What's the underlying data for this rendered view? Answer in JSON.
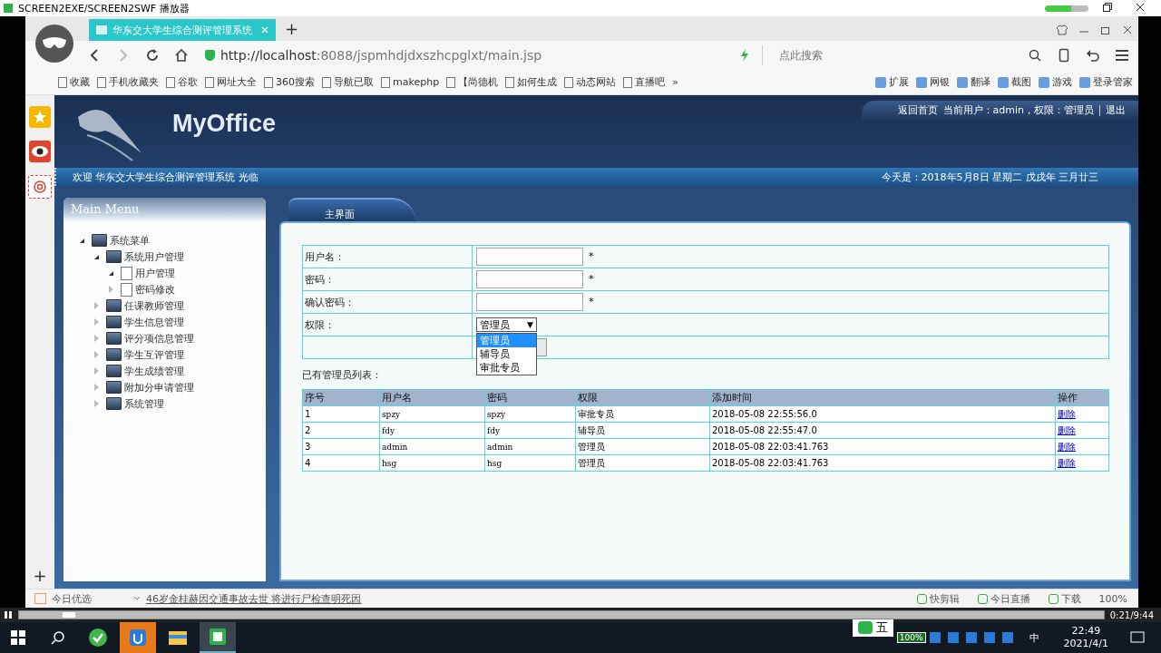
{
  "player": {
    "title": "SCREEN2EXE/SCREEN2SWF 播放器",
    "time": "0:21/9:44",
    "level": 0.04
  },
  "browser": {
    "tabs": [
      {
        "label": "华东交大学生综合测评管理系统",
        "selected": true
      }
    ],
    "new_tab": "+",
    "url_host": "http://localhost",
    "url_rest": ":8088/jspmhdjdxszhcpglxt/main.jsp",
    "search": {
      "placeholder": "点此搜索"
    },
    "bookmarks": [
      {
        "label": "收藏"
      },
      {
        "label": "手机收藏夹"
      },
      {
        "label": "谷歌"
      },
      {
        "label": "网址大全"
      },
      {
        "label": "360搜索"
      },
      {
        "label": "导航已取"
      },
      {
        "label": "makephp"
      },
      {
        "label": "【尚德机"
      },
      {
        "label": "如何生成"
      },
      {
        "label": "动态网站"
      },
      {
        "label": "直播吧"
      }
    ],
    "more": "»",
    "tools": [
      {
        "label": "扩展"
      },
      {
        "label": "网银"
      },
      {
        "label": "翻译"
      },
      {
        "label": "截图"
      },
      {
        "label": "游戏"
      },
      {
        "label": "登录管家"
      }
    ],
    "status": {
      "left": "今日优选",
      "news": "46岁金桂赫因交通事故去世 将进行尸检查明死因",
      "items": [
        {
          "label": "快剪辑"
        },
        {
          "label": "今日直播"
        },
        {
          "label": "下载"
        }
      ],
      "zoom": "100%"
    },
    "sidebar_add": "+"
  },
  "page": {
    "logo": "MyOffice",
    "top_links": [
      {
        "label": "返回首页"
      },
      {
        "label": "当前用户：admin，权限：管理员"
      },
      {
        "label": "退出"
      }
    ],
    "welcome": "欢迎 华东交大学生综合测评管理系统 光临",
    "today": "今天是：2018年5月8日 星期二 戊戌年 三月廿三",
    "menu_title": "Main Menu",
    "tree": [
      {
        "label": "系统菜单",
        "kind": "folder",
        "expanded": true,
        "children": [
          {
            "label": "系统用户管理",
            "kind": "folder",
            "expanded": true,
            "children": [
              {
                "label": "用户管理",
                "kind": "file",
                "expanded": true
              },
              {
                "label": "密码修改",
                "kind": "file",
                "expanded": false
              }
            ]
          },
          {
            "label": "任课教师管理",
            "kind": "folder",
            "expanded": false
          },
          {
            "label": "学生信息管理",
            "kind": "folder",
            "expanded": false
          },
          {
            "label": "评分项信息管理",
            "kind": "folder",
            "expanded": false
          },
          {
            "label": "学生互评管理",
            "kind": "folder",
            "expanded": false
          },
          {
            "label": "学生成绩管理",
            "kind": "folder",
            "expanded": false
          },
          {
            "label": "附加分申请管理",
            "kind": "folder",
            "expanded": false
          },
          {
            "label": "系统管理",
            "kind": "folder",
            "expanded": false
          }
        ]
      }
    ],
    "main_tab": {
      "label": "主界面",
      "selected": true
    },
    "form": [
      {
        "label": "用户名：",
        "kind": "text",
        "required": "*"
      },
      {
        "label": "密码：",
        "kind": "text",
        "required": "*"
      },
      {
        "label": "确认密码：",
        "kind": "text",
        "required": "*"
      },
      {
        "label": "权限：",
        "kind": "select",
        "value": "管理员",
        "arrow": "▼",
        "options": [
          {
            "label": "管理员",
            "selected": true
          },
          {
            "label": "辅导员",
            "selected": false
          },
          {
            "label": "审批专员",
            "selected": false
          }
        ]
      }
    ],
    "list_title": "已有管理员列表：",
    "table": {
      "columns": [
        "序号",
        "用户名",
        "密码",
        "权限",
        "添加时间",
        "操作"
      ],
      "rows": [
        [
          "1",
          "spzy",
          "spzy",
          "审批专员",
          "2018-05-08 22:55:56.0",
          "删除"
        ],
        [
          "2",
          "fdy",
          "fdy",
          "辅导员",
          "2018-05-08 22:55:47.0",
          "删除"
        ],
        [
          "3",
          "admin",
          "admin",
          "管理员",
          "2018-05-08 22:03:41.763",
          "删除"
        ],
        [
          "4",
          "hsg",
          "hsg",
          "管理员",
          "2018-05-08 22:03:41.763",
          "删除"
        ]
      ]
    }
  },
  "taskbar": {
    "ime": "五",
    "battery": "100%",
    "lang": "中",
    "time": "22:49",
    "date": "2021/4/1"
  }
}
